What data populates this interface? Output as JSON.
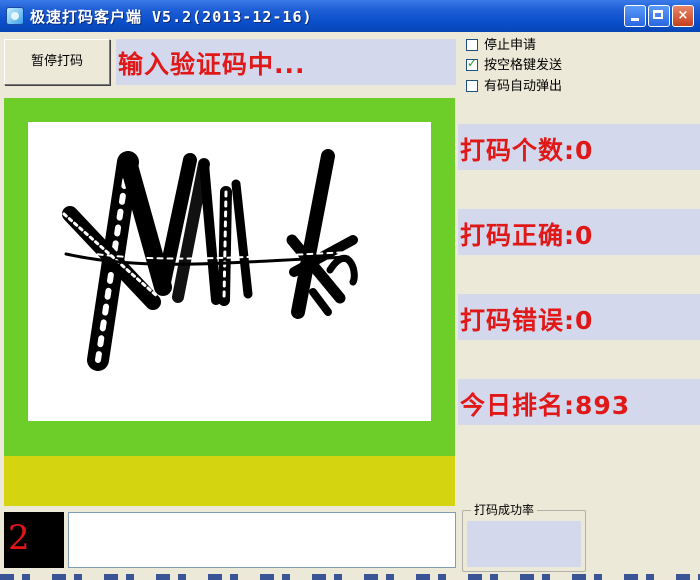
{
  "window": {
    "title": "极速打码客户端 V5.2(2013-12-16)",
    "icon": "app-icon",
    "controls": {
      "minimize": "minimize-icon",
      "maximize": "maximize-icon",
      "close": "×"
    }
  },
  "toolbar": {
    "pause_label": "暂停打码",
    "status_text": "输入验证码中..."
  },
  "options": [
    {
      "label": "停止申请",
      "checked": false
    },
    {
      "label": "按空格键发送",
      "checked": true
    },
    {
      "label": "有码自动弹出",
      "checked": false
    }
  ],
  "stats": {
    "count_label": "打码个数:0",
    "correct_label": "打码正确:0",
    "wrong_label": "打码错误:0",
    "rank_label": "今日排名:893"
  },
  "input": {
    "counter": "2",
    "code_value": ""
  },
  "rate": {
    "legend": "打码成功率",
    "value": ""
  },
  "colors": {
    "title_bar": "#0a4ec9",
    "status_red": "#e01818",
    "frame_green": "#6dce2a",
    "bar_yellow": "#d4d410",
    "panel_lavender": "#d4d8ec"
  }
}
